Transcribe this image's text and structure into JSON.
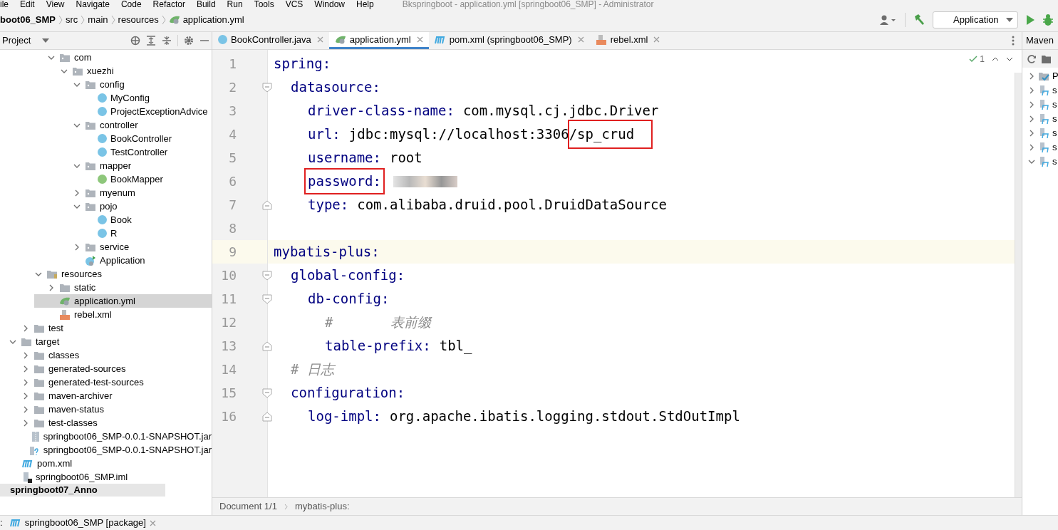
{
  "menu": [
    "ile",
    "Edit",
    "View",
    "Navigate",
    "Code",
    "Refactor",
    "Build",
    "Run",
    "Tools",
    "VCS",
    "Window",
    "Help"
  ],
  "window_title": "Bkspringboot - application.yml [springboot06_SMP] - Administrator",
  "breadcrumbs": [
    {
      "label": "boot06_SMP",
      "kind": "project"
    },
    {
      "label": "src",
      "kind": "plain"
    },
    {
      "label": "main",
      "kind": "plain"
    },
    {
      "label": "resources",
      "kind": "plain"
    },
    {
      "label": "application.yml",
      "kind": "yaml"
    }
  ],
  "run_config": "Application",
  "project_panel": {
    "title": "Project"
  },
  "tree": [
    {
      "label": "com",
      "kind": "package",
      "expanded": true,
      "children": [
        {
          "label": "xuezhi",
          "kind": "package",
          "expanded": true,
          "children": [
            {
              "label": "config",
              "kind": "package",
              "expanded": true,
              "children": [
                {
                  "label": "MyConfig",
                  "kind": "class"
                },
                {
                  "label": "ProjectExceptionAdvice",
                  "kind": "class"
                }
              ]
            },
            {
              "label": "controller",
              "kind": "package",
              "expanded": true,
              "children": [
                {
                  "label": "BookController",
                  "kind": "class"
                },
                {
                  "label": "TestController",
                  "kind": "class"
                }
              ]
            },
            {
              "label": "mapper",
              "kind": "package",
              "expanded": true,
              "children": [
                {
                  "label": "BookMapper",
                  "kind": "interface"
                }
              ]
            },
            {
              "label": "myenum",
              "kind": "package",
              "expanded": false
            },
            {
              "label": "pojo",
              "kind": "package",
              "expanded": true,
              "children": [
                {
                  "label": "Book",
                  "kind": "class"
                },
                {
                  "label": "R",
                  "kind": "class"
                }
              ]
            },
            {
              "label": "service",
              "kind": "package",
              "expanded": false
            },
            {
              "label": "Application",
              "kind": "app"
            }
          ]
        }
      ]
    }
  ],
  "tree2": [
    {
      "label": "resources",
      "kind": "resources",
      "expanded": true,
      "children": [
        {
          "label": "static",
          "kind": "folder",
          "expanded": false
        },
        {
          "label": "application.yml",
          "kind": "yaml",
          "selected": true
        },
        {
          "label": "rebel.xml",
          "kind": "xml",
          "selected": false
        }
      ]
    },
    {
      "label": "test",
      "kind": "folder",
      "expanded": false
    }
  ],
  "tree3": [
    {
      "label": "target",
      "kind": "folder",
      "expanded": true,
      "children": [
        {
          "label": "classes",
          "kind": "folder",
          "expanded": false
        },
        {
          "label": "generated-sources",
          "kind": "folder",
          "expanded": false
        },
        {
          "label": "generated-test-sources",
          "kind": "folder",
          "expanded": false
        },
        {
          "label": "maven-archiver",
          "kind": "folder",
          "expanded": false
        },
        {
          "label": "maven-status",
          "kind": "folder",
          "expanded": false
        },
        {
          "label": "test-classes",
          "kind": "folder",
          "expanded": false
        },
        {
          "label": "springboot06_SMP-0.0.1-SNAPSHOT.jar",
          "kind": "jar"
        },
        {
          "label": "springboot06_SMP-0.0.1-SNAPSHOT.jar",
          "kind": "unknown"
        }
      ]
    },
    {
      "label": "pom.xml",
      "kind": "maven"
    },
    {
      "label": "springboot06_SMP.iml",
      "kind": "iml"
    }
  ],
  "next_module": "springboot07_Anno",
  "tabs": [
    {
      "label": "BookController.java",
      "kind": "class",
      "selected": false
    },
    {
      "label": "application.yml",
      "kind": "yaml",
      "selected": true
    },
    {
      "label": "pom.xml (springboot06_SMP)",
      "kind": "maven",
      "selected": false
    },
    {
      "label": "rebel.xml",
      "kind": "xml",
      "selected": false
    }
  ],
  "inspections": "1",
  "code": [
    {
      "num": "1",
      "key": "spring:",
      "children": [
        {
          "num": "2",
          "key": "datasource:",
          "children": [
            {
              "num": "3",
              "key": "driver-class-name:",
              "value": "com.mysql.cj.jdbc.Driver"
            },
            {
              "num": "4",
              "key": "url:",
              "value": "jdbc:mysql://localhost:3306",
              "marked_value": "/sp_crud"
            },
            {
              "num": "5",
              "key": "username:",
              "value": "root"
            },
            {
              "num": "6",
              "key": "password:",
              "secret": true,
              "key_marked": true
            },
            {
              "num": "7",
              "key": "type:",
              "value": "com.alibaba.druid.pool.DruidDataSource"
            }
          ]
        }
      ]
    },
    {
      "num": "8"
    },
    {
      "num": "9",
      "key": "mybatis-plus:",
      "current": true,
      "children": [
        {
          "num": "10",
          "key": "global-config:",
          "children": [
            {
              "num": "11",
              "key": "db-config:",
              "children": [
                {
                  "num": "12",
                  "comment": "#       表前缀"
                },
                {
                  "num": "13",
                  "key": "table-prefix:",
                  "value": "tbl_"
                }
              ]
            }
          ]
        },
        {
          "num": "14",
          "comment": "# 日志"
        },
        {
          "num": "15",
          "key": "configuration:",
          "children": [
            {
              "num": "16",
              "key": "log-impl:",
              "value": "org.apache.ibatis.logging.stdout.StdOutImpl"
            }
          ]
        }
      ]
    }
  ],
  "editor_breadcrumbs": [
    "Document 1/1",
    "mybatis-plus:"
  ],
  "maven_panel": {
    "title": "Maven",
    "items": [
      {
        "label": "P",
        "kind": "profiles",
        "expanded": false
      },
      {
        "label": "s",
        "kind": "module",
        "expanded": false
      },
      {
        "label": "s",
        "kind": "module",
        "expanded": false
      },
      {
        "label": "s",
        "kind": "module",
        "expanded": false
      },
      {
        "label": "s",
        "kind": "module",
        "expanded": false
      },
      {
        "label": "s",
        "kind": "module",
        "expanded": false
      },
      {
        "label": "s",
        "kind": "module",
        "expanded": true
      }
    ]
  },
  "run_tab": {
    "prefix": ":",
    "label": "springboot06_SMP [package]"
  }
}
